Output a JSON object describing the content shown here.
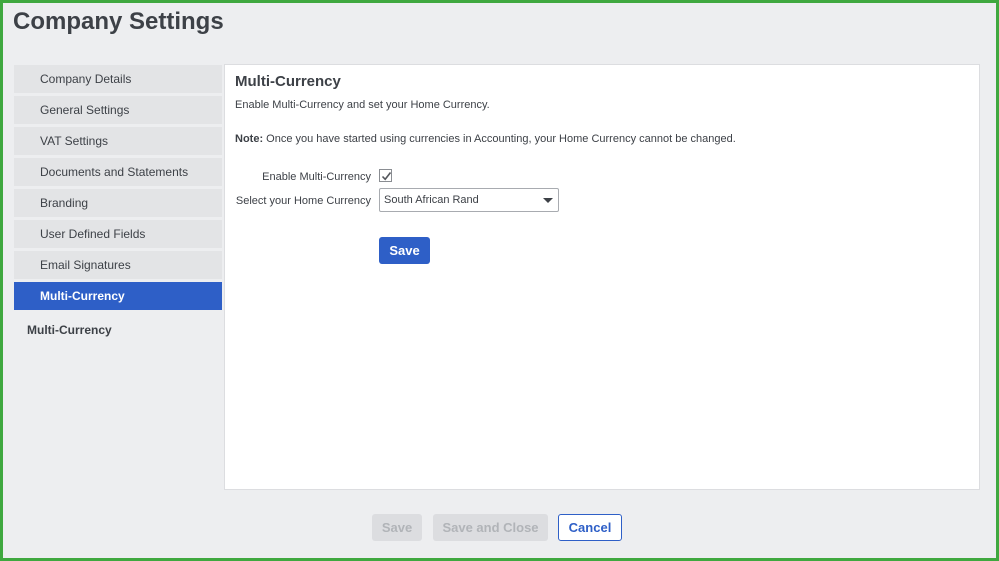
{
  "page": {
    "title": "Company Settings"
  },
  "sidebar": {
    "items": [
      {
        "label": "Company Details"
      },
      {
        "label": "General Settings"
      },
      {
        "label": "VAT Settings"
      },
      {
        "label": "Documents and Statements"
      },
      {
        "label": "Branding"
      },
      {
        "label": "User Defined Fields"
      },
      {
        "label": "Email Signatures"
      },
      {
        "label": "Multi-Currency",
        "active": true
      }
    ],
    "sub_label": "Multi-Currency"
  },
  "panel": {
    "title": "Multi-Currency",
    "description": "Enable Multi-Currency and set your Home Currency.",
    "note_prefix": "Note:",
    "note_text": " Once you have started using currencies in Accounting, your Home Currency cannot be changed.",
    "enable_label": "Enable Multi-Currency",
    "enable_checked": true,
    "currency_label": "Select your Home Currency",
    "currency_value": "South African Rand",
    "save_label": "Save"
  },
  "footer": {
    "save_label": "Save",
    "save_close_label": "Save and Close",
    "cancel_label": "Cancel"
  },
  "colors": {
    "accent": "#2e5fc7",
    "frame_border": "#3fa83f",
    "background": "#edeef0"
  }
}
